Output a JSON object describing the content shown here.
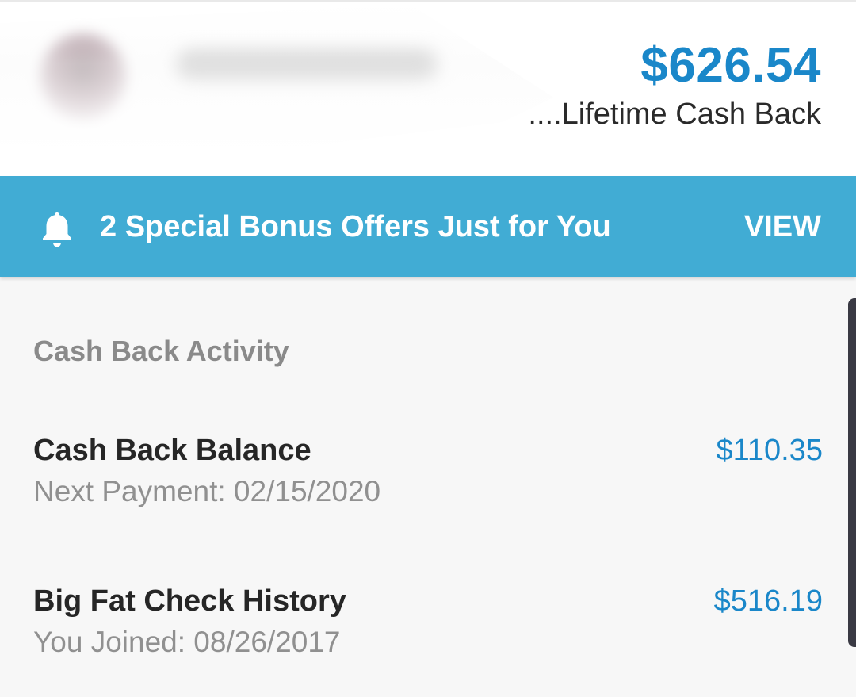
{
  "header": {
    "lifetime_amount": "$626.54",
    "lifetime_label": "....Lifetime Cash Back"
  },
  "banner": {
    "icon": "bell-icon",
    "text": "2 Special Bonus Offers Just for You",
    "action": "VIEW",
    "color": "#41acd4"
  },
  "activity": {
    "title": "Cash Back Activity",
    "rows": [
      {
        "title": "Cash Back Balance",
        "subtitle": "Next Payment: 02/15/2020",
        "amount": "$110.35"
      },
      {
        "title": "Big Fat Check History",
        "subtitle": "You Joined: 08/26/2017",
        "amount": "$516.19"
      }
    ]
  },
  "colors": {
    "accent": "#1a87c9",
    "banner": "#41acd4"
  }
}
